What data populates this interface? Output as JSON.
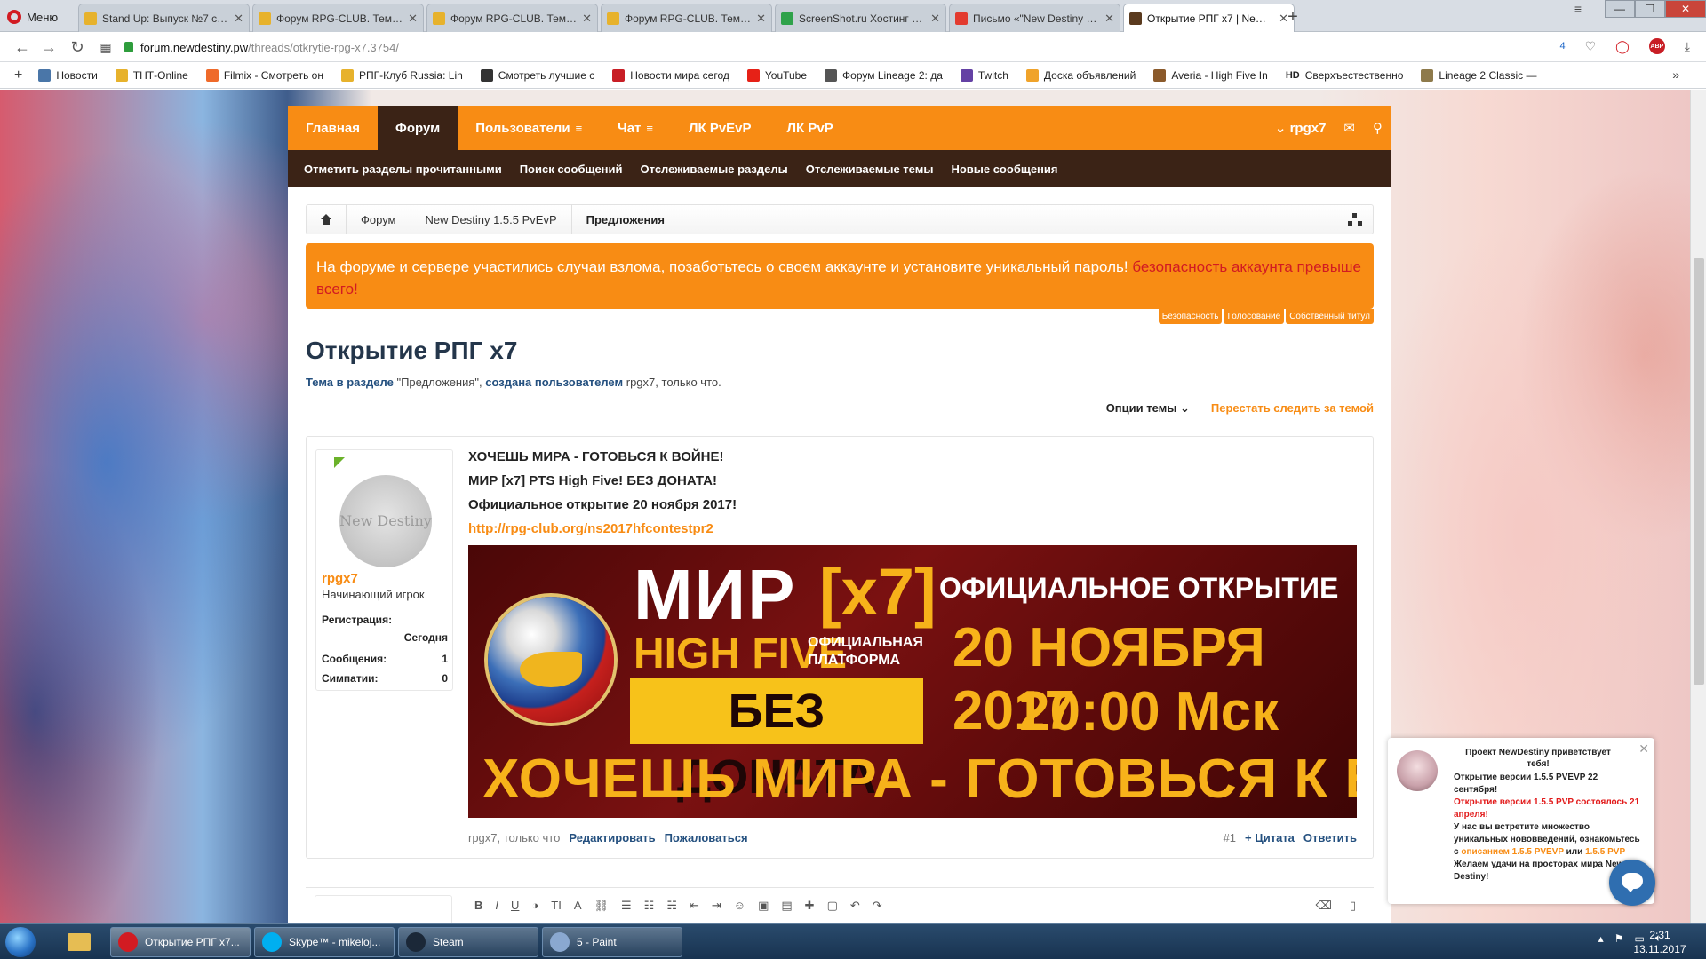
{
  "browser": {
    "menu_label": "Меню",
    "tabs": [
      {
        "title": "Stand Up: Выпуск №7 смо",
        "favicon_color": "#e7b22c"
      },
      {
        "title": "Форум RPG-CLUB. Тема: H",
        "favicon_color": "#e7b22c"
      },
      {
        "title": "Форум RPG-CLUB. Тема: H",
        "favicon_color": "#e7b22c"
      },
      {
        "title": "Форум RPG-CLUB. Тема: F",
        "favicon_color": "#e7b22c"
      },
      {
        "title": "ScreenShot.ru Хостинг кар",
        "favicon_color": "#2fa24a"
      },
      {
        "title": "Письмо «\"New Destiny Pe",
        "favicon_color": "#e33b2f"
      },
      {
        "title": "Открытие РПГ x7 | New D",
        "favicon_color": "#5a3a1e"
      }
    ],
    "tab_close": "✕",
    "new_tab": "+",
    "url_domain": "forum.newdestiny.pw",
    "url_path": "/threads/otkrytie-rpg-x7.3754/",
    "addr_count": "4",
    "bookmarks": [
      {
        "label": "Новости",
        "color": "#4a76a8"
      },
      {
        "label": "ТНТ-Online",
        "color": "#e7b22c"
      },
      {
        "label": "Filmix - Смотреть он",
        "color": "#ef6a2a"
      },
      {
        "label": "РПГ-Клуб Russia: Lin",
        "color": "#e7b22c"
      },
      {
        "label": "Смотреть лучшие с",
        "color": "#333333"
      },
      {
        "label": "Новости мира сегод",
        "color": "#c81e25"
      },
      {
        "label": "YouTube",
        "color": "#e62117"
      },
      {
        "label": "Форум Lineage 2: да",
        "color": "#555555"
      },
      {
        "label": "Twitch",
        "color": "#6441a4"
      },
      {
        "label": "Доска объявлений",
        "color": "#f0a32a"
      },
      {
        "label": "Averia - High Five In",
        "color": "#8b5a2b"
      },
      {
        "label": "Сверхъестественно",
        "color": "#111111"
      },
      {
        "label": "Lineage 2 Classic —",
        "color": "#8e7a4b"
      }
    ],
    "bookmark_hd": "HD",
    "bookmarks_more": "»"
  },
  "forum": {
    "nav": [
      {
        "label": "Главная",
        "menu": false,
        "active": false
      },
      {
        "label": "Форум",
        "menu": false,
        "active": true
      },
      {
        "label": "Пользователи",
        "menu": true,
        "active": false
      },
      {
        "label": "Чат",
        "menu": true,
        "active": false
      },
      {
        "label": "ЛК PvEvP",
        "menu": false,
        "active": false
      },
      {
        "label": "ЛК PvP",
        "menu": false,
        "active": false
      }
    ],
    "nav_menu_glyph": "≡",
    "account_name": "rpgx7",
    "subnav": [
      "Отметить разделы прочитанными",
      "Поиск сообщений",
      "Отслеживаемые разделы",
      "Отслеживаемые темы",
      "Новые сообщения"
    ],
    "breadcrumbs": [
      "Форум",
      "New Destiny 1.5.5 PvEvP",
      "Предложения"
    ],
    "notice": {
      "text": "На форуме и сервере участились случаи взлома, позаботьтесь о своем аккаунте и установите уникальный пароль! ",
      "link": "безопасность аккаунта превыше всего!"
    },
    "notice_tags": [
      "Безопасность",
      "Голосование",
      "Собственный титул"
    ],
    "thread": {
      "title": "Открытие РПГ x7",
      "meta_prefix": "Тема в разделе",
      "meta_forum": "\"Предложения\"",
      "meta_created": "создана пользователем",
      "meta_user": "rpgx7",
      "meta_time": "только что.",
      "options_label": "Опции темы",
      "unwatch_label": "Перестать следить за темой"
    },
    "post": {
      "avatar_text": "New Destiny",
      "username": "rpgx7",
      "user_title": "Начинающий игрок",
      "stats": {
        "reg_label": "Регистрация:",
        "reg_value": "Сегодня",
        "msg_label": "Сообщения:",
        "msg_value": "1",
        "likes_label": "Симпатии:",
        "likes_value": "0"
      },
      "lines": [
        "ХОЧЕШЬ МИРА - ГОТОВЬСЯ К ВОЙНЕ!",
        "МИР [x7] PTS High Five! БЕЗ ДОНАТА!",
        "Официальное открытие 20 ноября 2017!"
      ],
      "link": "http://rpg-club.org/ns2017hfcontestpr2",
      "banner": {
        "mir": "МИР",
        "x7": "[x7]",
        "high_five": "HIGH FIVE",
        "platform": "ОФИЦИАЛЬНАЯ ПЛАТФОРМА",
        "no_donate": "БЕЗ ДОНАТА",
        "official": "ОФИЦИАЛЬНОЕ ОТКРЫТИЕ",
        "date": "20 НОЯБРЯ 2017",
        "time": "20:00 Мск",
        "war": "ХОЧЕШЬ МИРА - ГОТОВЬСЯ К ВОЙНЕ"
      },
      "footer_user": "rpgx7, только что",
      "edit": "Редактировать",
      "report": "Пожаловаться",
      "number": "#1",
      "quote": "+ Цитата",
      "reply": "Ответить"
    }
  },
  "popup": {
    "title": "Проект NewDestiny приветствует тебя!",
    "line1": "Открытие версии 1.5.5 PVEVP 22 сентября!",
    "line2": "Открытие версии 1.5.5 PVP состоялось 21 апреля!",
    "line3": "У нас вы встретите множество уникальных нововведений, ознакомьтесь с ",
    "line3_link": "описанием 1.5.5 PVEVP",
    "line3_or": " или ",
    "line3_link2": "1.5.5 PVP",
    "line4": "Желаем удачи на просторах мира New Destiny!",
    "close": "✕"
  },
  "taskbar": {
    "tasks": [
      {
        "label": "Открытие РПГ x7...",
        "color": "#d21b22",
        "active": true
      },
      {
        "label": "Skype™ - mikeloj...",
        "color": "#00aff0",
        "active": false
      },
      {
        "label": "Steam",
        "color": "#1b2838",
        "active": false
      },
      {
        "label": "5 - Paint",
        "color": "#8aa8d0",
        "active": false
      }
    ],
    "time": "2:31",
    "date": "13.11.2017"
  }
}
